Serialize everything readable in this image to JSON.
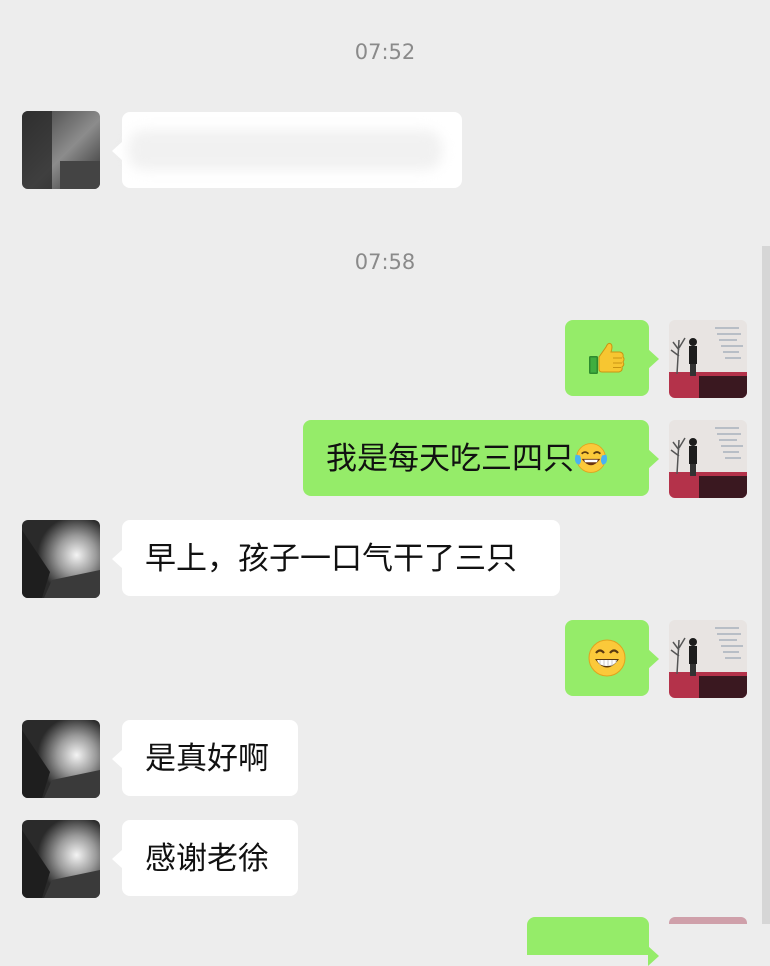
{
  "chat": {
    "timestamps": [
      "07:52",
      "07:58"
    ],
    "messages": [
      {
        "side": "in",
        "text": "",
        "note": "blurred"
      },
      {
        "side": "out",
        "emoji": "thumbs-up"
      },
      {
        "side": "out",
        "text": "我是每天吃三四只",
        "emoji": "laughing-crying"
      },
      {
        "side": "in",
        "text": "早上，孩子一口气干了三只"
      },
      {
        "side": "out",
        "emoji": "grinning-face"
      },
      {
        "side": "in",
        "text": "是真好啊"
      },
      {
        "side": "in",
        "text": "感谢老徐"
      }
    ]
  },
  "colors": {
    "background": "#ededed",
    "incoming_bubble": "#ffffff",
    "outgoing_bubble": "#95ec69",
    "timestamp": "#8a8a8a"
  }
}
